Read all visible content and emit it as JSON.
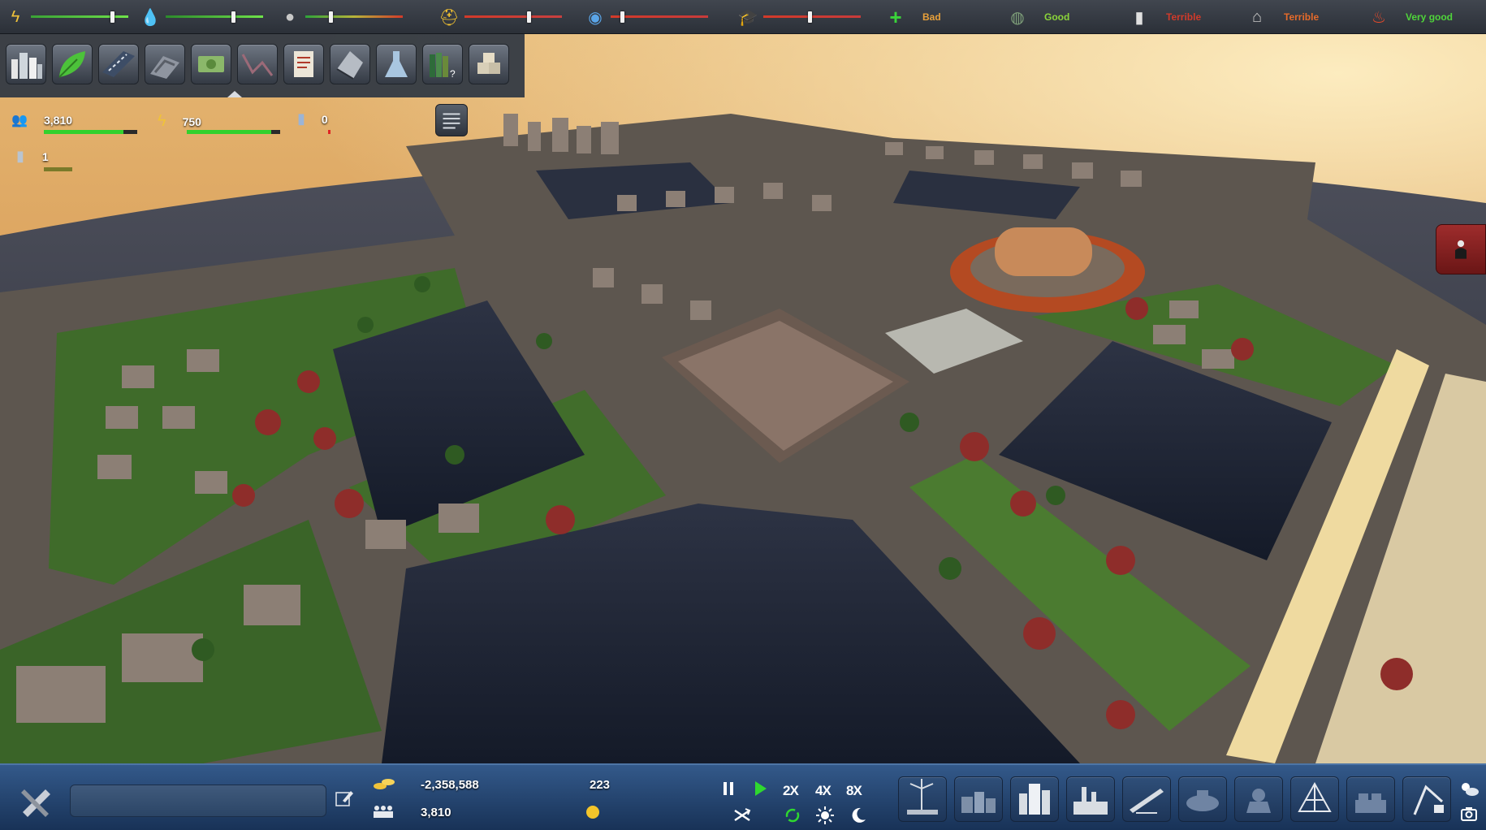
{
  "top_bar": {
    "meters": [
      {
        "id": "power",
        "icon": "lightning-icon",
        "level": 0.85
      },
      {
        "id": "water",
        "icon": "water-drop-icon",
        "level": 0.7
      },
      {
        "id": "waste",
        "icon": "trash-bag-icon",
        "level": 0.25
      },
      {
        "id": "health",
        "icon": "medic-icon",
        "level": 0.67
      },
      {
        "id": "police",
        "icon": "police-icon",
        "level": 0.1
      },
      {
        "id": "education",
        "icon": "graduate-icon",
        "level": 0.48
      }
    ],
    "indicators": [
      {
        "id": "healthcare",
        "icon": "green-cross-icon",
        "label": "Bad",
        "color": "#e8a03a"
      },
      {
        "id": "environment",
        "icon": "globe-icon",
        "label": "Good",
        "color": "#8bd43a"
      },
      {
        "id": "education-level",
        "icon": "book-icon",
        "label": "Terrible",
        "color": "#d23a2a"
      },
      {
        "id": "housing",
        "icon": "house-icon",
        "label": "Terrible",
        "color": "#e56a2a"
      },
      {
        "id": "safety",
        "icon": "fire-icon",
        "label": "Very good",
        "color": "#4fd43a"
      }
    ]
  },
  "categories": [
    {
      "name": "category-residential",
      "icon": "city-icon"
    },
    {
      "name": "category-nature",
      "icon": "leaf-icon"
    },
    {
      "name": "category-roads",
      "icon": "road-icon"
    },
    {
      "name": "category-industry",
      "icon": "factory-icon"
    },
    {
      "name": "category-money",
      "icon": "money-icon"
    },
    {
      "name": "category-graph",
      "icon": "graph-icon"
    },
    {
      "name": "category-documents",
      "icon": "document-icon"
    },
    {
      "name": "category-city-hall",
      "icon": "building-icon"
    },
    {
      "name": "category-science",
      "icon": "flask-icon"
    },
    {
      "name": "category-library",
      "icon": "books-icon"
    },
    {
      "name": "category-storage",
      "icon": "boxes-icon"
    }
  ],
  "stats": {
    "population": "3,810",
    "population_fill": 0.85,
    "power": "750",
    "power_fill": 0.9,
    "water": "0",
    "water_fill": 0.12,
    "buildings": "1",
    "buildings_fill": 0.5
  },
  "bottom_bar": {
    "money": "-2,358,588",
    "citizens": "3,810",
    "happiness": "223",
    "speeds": [
      "2X",
      "4X",
      "8X"
    ]
  },
  "tools": [
    {
      "name": "tool-wind-turbine",
      "icon": "wind-turbine-icon"
    },
    {
      "name": "tool-houses",
      "icon": "houses-icon"
    },
    {
      "name": "tool-high-rise",
      "icon": "skyscraper-icon"
    },
    {
      "name": "tool-factory",
      "icon": "factory-icon"
    },
    {
      "name": "tool-bridge",
      "icon": "bridge-icon"
    },
    {
      "name": "tool-stadium",
      "icon": "stadium-icon"
    },
    {
      "name": "tool-monument",
      "icon": "monument-icon"
    },
    {
      "name": "tool-dome",
      "icon": "dome-icon"
    },
    {
      "name": "tool-warehouse",
      "icon": "warehouse-icon"
    },
    {
      "name": "tool-crane",
      "icon": "crane-icon"
    }
  ]
}
